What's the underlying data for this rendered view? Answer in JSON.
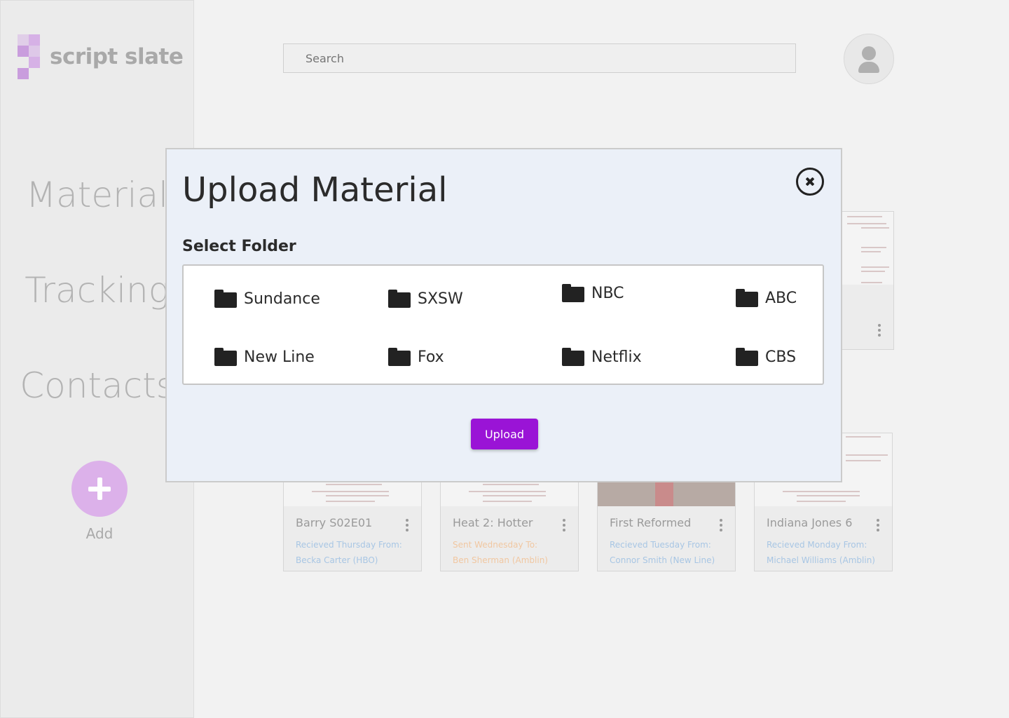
{
  "app": {
    "logo_text": "script slate"
  },
  "sidebar": {
    "items": [
      {
        "label": "Material"
      },
      {
        "label": "Tracking"
      },
      {
        "label": "Contacts"
      }
    ],
    "add_label": "Add"
  },
  "header": {
    "search_placeholder": "Search"
  },
  "cards": [
    {
      "title": "Barry S02E01",
      "line1": "Recieved Thursday From:",
      "line2": "Becka Carter (HBO)",
      "status": "received"
    },
    {
      "title": "Heat 2: Hotter",
      "line1": "Sent Wednesday To:",
      "line2": "Ben Sherman (Amblin)",
      "status": "sent"
    },
    {
      "title": "First Reformed",
      "line1": "Recieved Tuesday From:",
      "line2": "Connor Smith (New Line)",
      "status": "received"
    },
    {
      "title": "Indiana Jones 6",
      "line1": "Recieved Monday From:",
      "line2": "Michael Williams (Amblin)",
      "status": "received"
    }
  ],
  "modal": {
    "title": "Upload Material",
    "select_label": "Select Folder",
    "folders": [
      {
        "name": "Sundance"
      },
      {
        "name": "SXSW"
      },
      {
        "name": "NBC"
      },
      {
        "name": "ABC"
      },
      {
        "name": "New Line"
      },
      {
        "name": "Fox"
      },
      {
        "name": "Netflix"
      },
      {
        "name": "CBS"
      }
    ],
    "upload_label": "Upload"
  },
  "colors": {
    "accent": "#9a14d6",
    "logo_accent": "#d6b1e6",
    "received_text": "#a8c6e4",
    "sent_text": "#f1c7a1"
  }
}
